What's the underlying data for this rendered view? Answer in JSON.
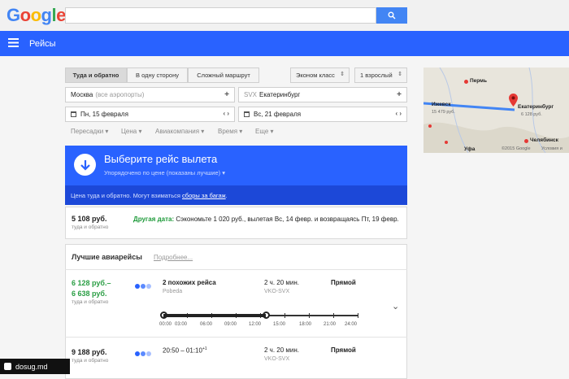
{
  "header": {
    "logo_letters": [
      {
        "ch": "G",
        "color": "#4285f4"
      },
      {
        "ch": "o",
        "color": "#ea4335"
      },
      {
        "ch": "o",
        "color": "#fbbc05"
      },
      {
        "ch": "g",
        "color": "#4285f4"
      },
      {
        "ch": "l",
        "color": "#34a853"
      },
      {
        "ch": "e",
        "color": "#ea4335"
      }
    ],
    "search_value": "",
    "app_title": "Рейсы"
  },
  "options": {
    "trip_types": [
      "Туда и обратно",
      "В одну сторону",
      "Сложный маршрут"
    ],
    "cabin_class": "Эконом класс",
    "passengers": "1 взрослый"
  },
  "route": {
    "origin_city": "Москва",
    "origin_note": "(все аэропорты)",
    "destination_code": "SVX",
    "destination_city": "Екатеринбург",
    "depart_date": "Пн, 15 февраля",
    "return_date": "Вс, 21 февраля"
  },
  "filters": [
    "Пересадки",
    "Цена",
    "Авиакомпания",
    "Время",
    "Еще"
  ],
  "panel": {
    "title": "Выберите рейс вылета",
    "subtitle": "Упорядочено по цене (показаны лучшие)",
    "note_prefix": "Цена туда и обратно. Могут взиматься",
    "note_link": "сборы за багаж",
    "note_suffix": "."
  },
  "date_hint": {
    "price": "5 108 руб.",
    "sub": "туда и обратно",
    "label": "Другая дата:",
    "text": "Сэкономьте 1 020 руб., вылетая Вс, 14 февр. и возвращаясь Пт, 19 февр."
  },
  "best": {
    "title": "Лучшие авиарейсы",
    "more": "Подробнее..."
  },
  "flight1": {
    "price_from": "6 128 руб.–",
    "price_to": "6 638 руб.",
    "sub": "туда и обратно",
    "title": "2 похожих рейса",
    "airline": "Pobeda",
    "duration": "2 ч. 20 мин.",
    "route": "VKO-SVX",
    "stops": "Прямой"
  },
  "timeline": [
    "00:00",
    "03:00",
    "06:00",
    "09:00",
    "12:00",
    "15:00",
    "18:00",
    "21:00",
    "24:00"
  ],
  "flight2": {
    "price": "9 188 руб.",
    "sub": "туда и обратно",
    "time": "20:50 – 01:10",
    "time_sup": "+1",
    "duration": "2 ч. 20 мин.",
    "route": "VKO-SVX",
    "stops": "Прямой"
  },
  "map": {
    "city_perm": "Пермь",
    "city_izhevsk": "Ижевск",
    "izhevsk_price": "15 479 руб.",
    "city_ekb": "Екатеринбург",
    "ekb_price": "6 128 руб.",
    "city_chel": "Челябинск",
    "city_ufa": "Уфа",
    "copyright": "©2015 Google",
    "terms": "Условия и"
  },
  "colors": {
    "accent": "#2962ff",
    "price_green": "#2a9e44",
    "dots": [
      "#2962ff",
      "#5c8bff",
      "#a8c0ff"
    ]
  },
  "watermark": "dosug.md"
}
